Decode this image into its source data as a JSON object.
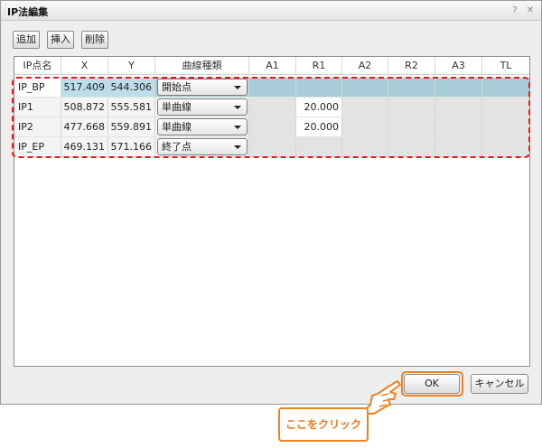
{
  "window": {
    "title": "IP法編集",
    "help_glyph": "?",
    "close_glyph": "✕"
  },
  "toolbar": {
    "add_label": "追加",
    "insert_label": "挿入",
    "delete_label": "削除"
  },
  "table": {
    "columns": [
      "IP点名",
      "X",
      "Y",
      "曲線種類",
      "A1",
      "R1",
      "A2",
      "R2",
      "A3",
      "TL"
    ],
    "rows": [
      {
        "name": "IP_BP",
        "x": "517.409",
        "y": "544.306",
        "curve": "開始点",
        "a1": "",
        "r1": "",
        "a2": "",
        "r2": "",
        "a3": "",
        "tl": "",
        "selected": true
      },
      {
        "name": "IP1",
        "x": "508.872",
        "y": "555.581",
        "curve": "単曲線",
        "a1": "",
        "r1": "20.000",
        "a2": "",
        "r2": "",
        "a3": "",
        "tl": ""
      },
      {
        "name": "IP2",
        "x": "477.668",
        "y": "559.891",
        "curve": "単曲線",
        "a1": "",
        "r1": "20.000",
        "a2": "",
        "r2": "",
        "a3": "",
        "tl": ""
      },
      {
        "name": "IP_EP",
        "x": "469.131",
        "y": "571.166",
        "curve": "終了点",
        "a1": "",
        "r1": "",
        "a2": "",
        "r2": "",
        "a3": "",
        "tl": ""
      }
    ]
  },
  "footer": {
    "ok_label": "OK",
    "cancel_label": "キャンセル"
  },
  "annotation": {
    "callout_text": "ここをクリック",
    "highlight_color": "#e8181f",
    "callout_color": "#f08020"
  }
}
